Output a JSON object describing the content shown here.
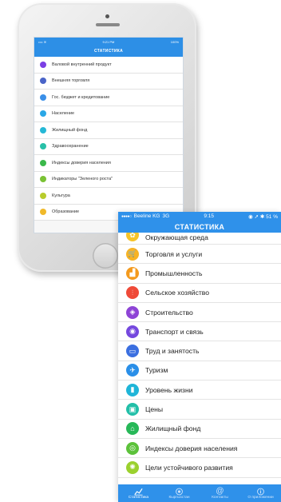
{
  "back_phone": {
    "status": {
      "left": "•••• ≋",
      "time": "9:21 PM",
      "battery": "100%"
    },
    "title": "СТАТИСТИКА",
    "items": [
      {
        "label": "Валовой внутренний продукт",
        "color": "#7b3fe4"
      },
      {
        "label": "Внешняя торговля",
        "color": "#4a64c8"
      },
      {
        "label": "Гос. бюджет и кредитование",
        "color": "#3a8fe8"
      },
      {
        "label": "Население",
        "color": "#2aa7e6"
      },
      {
        "label": "Жилищный фонд",
        "color": "#25b8d6"
      },
      {
        "label": "Здравоохранение",
        "color": "#28c0a8"
      },
      {
        "label": "Индексы доверия населения",
        "color": "#3ab84a"
      },
      {
        "label": "Индикаторы \"Зеленого роста\"",
        "color": "#7ac234"
      },
      {
        "label": "Культура",
        "color": "#b8cc2c"
      },
      {
        "label": "Образование",
        "color": "#f0b92a"
      }
    ]
  },
  "front": {
    "status": {
      "carrier": "Beeline KG",
      "network": "3G",
      "time": "9:15",
      "right": "◉ ➚ ✱ 51 %"
    },
    "title": "СТАТИСТИКА",
    "items": [
      {
        "label": "Окружающая среда",
        "color": "#f7c428",
        "icon": "environment-icon"
      },
      {
        "label": "Торговля и услуги",
        "color": "#f7b324",
        "icon": "cart-icon"
      },
      {
        "label": "Промышленность",
        "color": "#f49a1e",
        "icon": "factory-icon"
      },
      {
        "label": "Сельское хозяйство",
        "color": "#ef4a38",
        "icon": "agriculture-icon"
      },
      {
        "label": "Строительство",
        "color": "#8e44d6",
        "icon": "construction-icon"
      },
      {
        "label": "Транспорт и связь",
        "color": "#7548de",
        "icon": "transport-icon"
      },
      {
        "label": "Труд и занятость",
        "color": "#3b6fe0",
        "icon": "briefcase-icon"
      },
      {
        "label": "Туризм",
        "color": "#2a8fe8",
        "icon": "tourism-icon"
      },
      {
        "label": "Уровень жизни",
        "color": "#1fb5d8",
        "icon": "living-standard-icon"
      },
      {
        "label": "Цены",
        "color": "#22bfa8",
        "icon": "prices-icon"
      },
      {
        "label": "Жилищный фонд",
        "color": "#27b858",
        "icon": "house-icon"
      },
      {
        "label": "Индексы доверия населения",
        "color": "#5cc23a",
        "icon": "trust-index-icon"
      },
      {
        "label": "Цели устойчивого развития",
        "color": "#9bd12e",
        "icon": "sdg-icon"
      }
    ],
    "tabs": [
      {
        "label": "Статистика",
        "icon": "chart-icon",
        "active": true
      },
      {
        "label": "Кыргызстан",
        "icon": "emblem-icon",
        "active": false
      },
      {
        "label": "Контакты",
        "icon": "at-icon",
        "active": false
      },
      {
        "label": "О приложении",
        "icon": "info-icon",
        "active": false
      }
    ]
  }
}
